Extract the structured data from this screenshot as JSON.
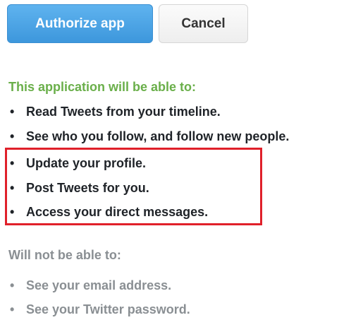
{
  "buttons": {
    "authorize_label": "Authorize app",
    "cancel_label": "Cancel"
  },
  "permissions": {
    "can_heading": "This application will be able to:",
    "can_items": [
      "Read Tweets from your timeline.",
      "See who you follow, and follow new people.",
      "Update your profile.",
      "Post Tweets for you.",
      "Access your direct messages."
    ],
    "cannot_heading": "Will not be able to:",
    "cannot_items": [
      "See your email address.",
      "See your Twitter password."
    ]
  },
  "bullet_char": "•",
  "colors": {
    "authorize_bg": "#3d97dc",
    "can_heading": "#6aaf4a",
    "cannot_text": "#8a8f93",
    "highlight_border": "#e0202a"
  }
}
